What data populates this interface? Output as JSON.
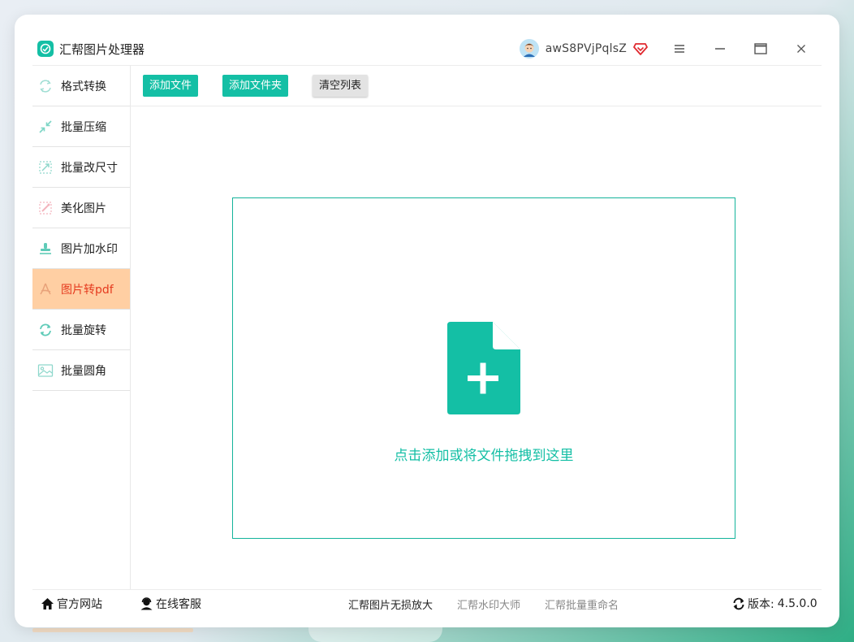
{
  "app": {
    "title": "汇帮图片处理器",
    "accent_color": "#14bfa5",
    "active_color": "#ffcfa3",
    "active_text_color": "#e53b1f"
  },
  "user": {
    "name": "awS8PVjPqlsZ",
    "avatar_icon": "user-avatar-icon",
    "vip_icon": "vip-diamond-icon"
  },
  "window_controls": {
    "menu_icon": "hamburger-menu-icon",
    "minimize_icon": "minimize-icon",
    "maximize_icon": "maximize-icon",
    "close_icon": "close-icon"
  },
  "sidebar": {
    "items": [
      {
        "label": "格式转换",
        "icon": "format-convert-icon",
        "active": false
      },
      {
        "label": "批量压缩",
        "icon": "compress-icon",
        "active": false
      },
      {
        "label": "批量改尺寸",
        "icon": "resize-icon",
        "active": false
      },
      {
        "label": "美化图片",
        "icon": "beautify-icon",
        "active": false
      },
      {
        "label": "图片加水印",
        "icon": "watermark-stamp-icon",
        "active": false
      },
      {
        "label": "图片转pdf",
        "icon": "pdf-icon",
        "active": true
      },
      {
        "label": "批量旋转",
        "icon": "rotate-icon",
        "active": false
      },
      {
        "label": "批量圆角",
        "icon": "rounded-corner-image-icon",
        "active": false
      }
    ]
  },
  "toolbar": {
    "add_file": "添加文件",
    "add_folder": "添加文件夹",
    "clear_list": "清空列表"
  },
  "dropzone": {
    "icon": "add-file-icon",
    "text": "点击添加或将文件拖拽到这里"
  },
  "footer": {
    "website": "官方网站",
    "website_icon": "home-icon",
    "support": "在线客服",
    "support_icon": "headset-user-icon",
    "links": [
      "汇帮图片无损放大",
      "汇帮水印大师",
      "汇帮批量重命名"
    ],
    "version_label": "版本:",
    "version": "4.5.0.0",
    "version_icon": "refresh-icon"
  }
}
